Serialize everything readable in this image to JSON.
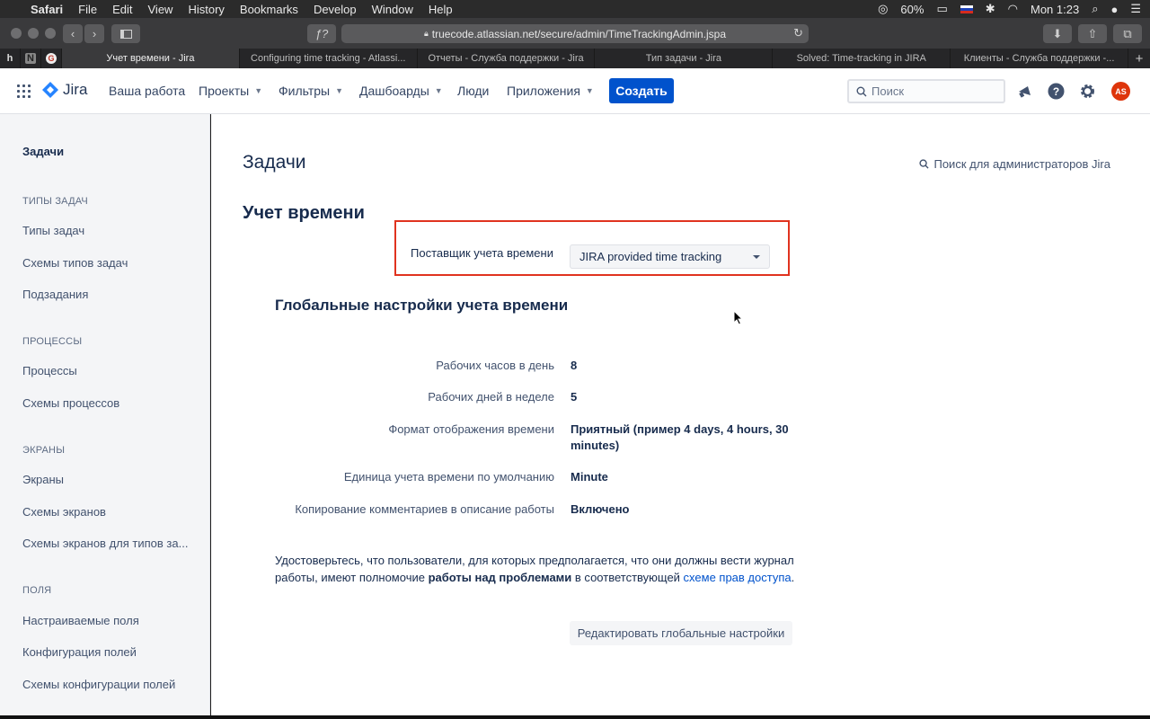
{
  "menubar": {
    "app": "Safari",
    "items": [
      "File",
      "Edit",
      "View",
      "History",
      "Bookmarks",
      "Develop",
      "Window",
      "Help"
    ],
    "battery": "60%",
    "clock": "Mon 1:23"
  },
  "browser": {
    "url": "truecode.atlassian.net/secure/admin/TimeTrackingAdmin.jspa",
    "pinned": [
      "h",
      "N",
      "G"
    ],
    "tabs": [
      "Учет времени - Jira",
      "Configuring time tracking - Atlassi...",
      "Отчеты - Служба поддержки - Jira",
      "Тип задачи - Jira",
      "Solved: Time-tracking in JIRA",
      "Клиенты - Служба поддержки -..."
    ],
    "new_tab": "+"
  },
  "header": {
    "logo_text": "Jira",
    "nav": {
      "your_work": "Ваша работа",
      "projects": "Проекты",
      "filters": "Фильтры",
      "dashboards": "Дашбоарды",
      "people": "Люди",
      "apps": "Приложения"
    },
    "create_label": "Создать",
    "search_placeholder": "Поиск",
    "avatar_initials": "AS"
  },
  "sidebar": {
    "title": "Задачи",
    "groups": [
      {
        "label": "ТИПЫ ЗАДАЧ",
        "items": [
          "Типы задач",
          "Схемы типов задач",
          "Подзадания"
        ]
      },
      {
        "label": "ПРОЦЕССЫ",
        "items": [
          "Процессы",
          "Схемы процессов"
        ]
      },
      {
        "label": "ЭКРАНЫ",
        "items": [
          "Экраны",
          "Схемы экранов",
          "Схемы экранов для типов за..."
        ]
      },
      {
        "label": "ПОЛЯ",
        "items": [
          "Настраиваемые поля",
          "Конфигурация полей",
          "Схемы конфигурации полей"
        ]
      }
    ]
  },
  "main": {
    "page_title": "Задачи",
    "admin_search": "Поиск для администраторов Jira",
    "section_title": "Учет времени",
    "provider": {
      "label": "Поставщик учета времени",
      "value": "JIRA provided time tracking"
    },
    "global_title": "Глобальные настройки учета времени",
    "settings": [
      {
        "label": "Рабочих часов в день",
        "value": "8"
      },
      {
        "label": "Рабочих дней в неделе",
        "value": "5"
      },
      {
        "label": "Формат отображения времени",
        "value": "Приятный (пример 4 days, 4 hours, 30 minutes)"
      },
      {
        "label": "Единица учета времени по умолчанию",
        "value": "Minute"
      },
      {
        "label": "Копирование комментариев в описание работы",
        "value": "Включено"
      }
    ],
    "note": {
      "part1": "Удостоверьтесь, что пользователи, для которых предполагается, что они должны вести журнал работы, имеют полномочие ",
      "bold": "работы над проблемами",
      "part2": " в соответствующей ",
      "link": "схеме прав доступа",
      "part3": "."
    },
    "edit_button": "Редактировать глобальные настройки"
  },
  "colors": {
    "primary": "#0052cc",
    "highlight_border": "#e0331f",
    "avatar": "#de350b"
  }
}
